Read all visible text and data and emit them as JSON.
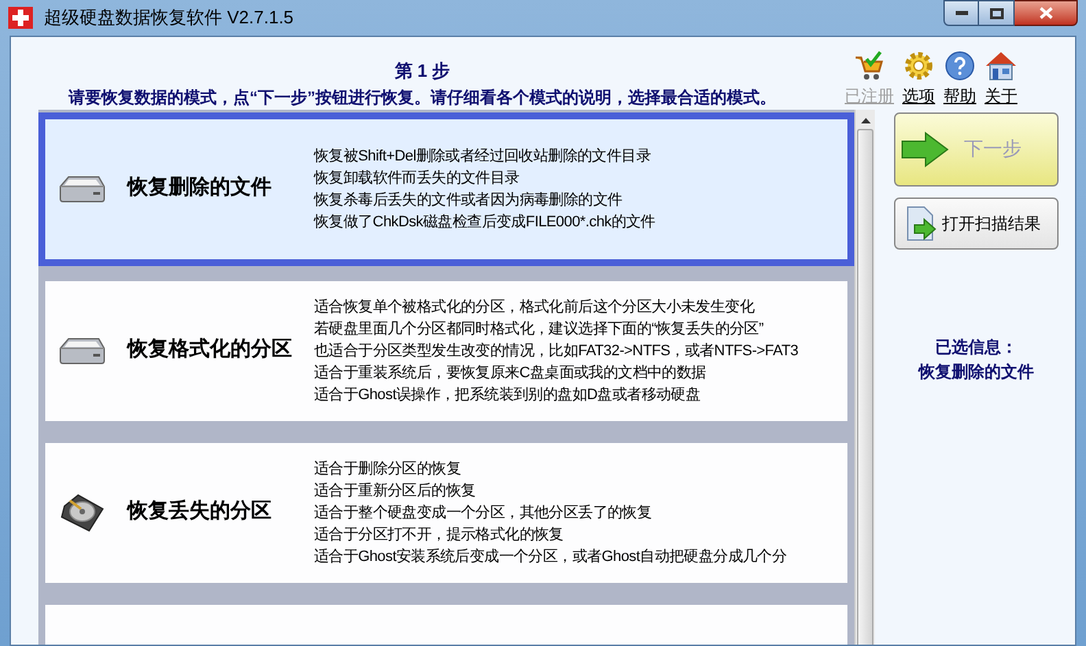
{
  "window": {
    "title": "超级硬盘数据恢复软件 V2.7.1.5"
  },
  "header": {
    "step": "第 1 步",
    "instruction": "请要恢复数据的模式，点“下一步”按钮进行恢复。请仔细看各个模式的说明，选择最合适的模式。"
  },
  "toolbar": [
    {
      "kind": "cart",
      "label": "已注册",
      "disabled": true
    },
    {
      "kind": "gear",
      "label": "选项",
      "disabled": false
    },
    {
      "kind": "help",
      "label": "帮助",
      "disabled": false
    },
    {
      "kind": "home",
      "label": "关于",
      "disabled": false
    }
  ],
  "modes": [
    {
      "kind": "drive",
      "title": "恢复删除的文件",
      "selected": true,
      "lines": [
        "恢复被Shift+Del删除或者经过回收站删除的文件目录",
        "恢复卸载软件而丢失的文件目录",
        "恢复杀毒后丢失的文件或者因为病毒删除的文件",
        "恢复做了ChkDsk磁盘检查后变成FILE000*.chk的文件"
      ]
    },
    {
      "kind": "drive",
      "title": "恢复格式化的分区",
      "selected": false,
      "lines": [
        "适合恢复单个被格式化的分区，格式化前后这个分区大小未发生变化",
        "若硬盘里面几个分区都同时格式化，建议选择下面的“恢复丢失的分区”",
        "也适合于分区类型发生改变的情况，比如FAT32->NTFS，或者NTFS->FAT3",
        "适合于重装系统后，要恢复原来C盘桌面或我的文档中的数据",
        "适合于Ghost误操作，把系统装到别的盘如D盘或者移动硬盘"
      ]
    },
    {
      "kind": "disk",
      "title": "恢复丢失的分区",
      "selected": false,
      "lines": [
        "适合于删除分区的恢复",
        "适合于重新分区后的恢复",
        "适合于整个硬盘变成一个分区，其他分区丢了的恢复",
        "适合于分区打不开，提示格式化的恢复",
        "适合于Ghost安装系统后变成一个分区，或者Ghost自动把硬盘分成几个分"
      ]
    }
  ],
  "buttons": [
    {
      "kind": "next",
      "label": "下一步",
      "disabled": true
    },
    {
      "kind": "open",
      "label": "打开扫描结果",
      "disabled": false
    }
  ],
  "selected_info": {
    "label": "已选信息：",
    "value": "恢复删除的文件"
  }
}
